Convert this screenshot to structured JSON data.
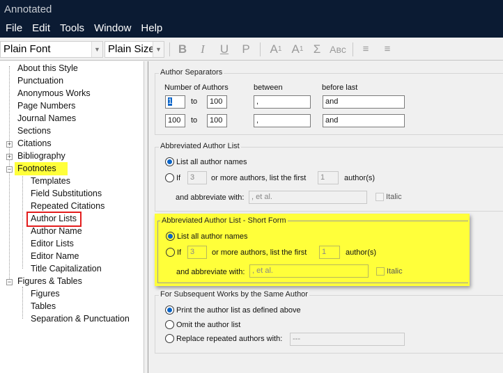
{
  "window": {
    "title": "Annotated"
  },
  "menu": [
    "File",
    "Edit",
    "Tools",
    "Window",
    "Help"
  ],
  "toolbar": {
    "font": "Plain Font",
    "size": "Plain Size",
    "bold": "B",
    "italic": "I",
    "underline": "U",
    "plain": "P",
    "superscript_a": "A",
    "superscript_1": "1",
    "subscript_a": "A",
    "subscript_1": "1",
    "symbol": "Σ",
    "smallcaps": "Aʙᴄ"
  },
  "tree": {
    "about": "About this Style",
    "punctuation": "Punctuation",
    "anonymous": "Anonymous Works",
    "page_numbers": "Page Numbers",
    "journal_names": "Journal Names",
    "sections": "Sections",
    "citations": "Citations",
    "bibliography": "Bibliography",
    "footnotes": "Footnotes",
    "templates": "Templates",
    "field_subs": "Field Substitutions",
    "repeated": "Repeated Citations",
    "author_lists": "Author Lists",
    "author_name": "Author Name",
    "editor_lists": "Editor Lists",
    "editor_name": "Editor Name",
    "title_cap": "Title Capitalization",
    "figures_tables": "Figures & Tables",
    "figures": "Figures",
    "tables": "Tables",
    "sep_punct": "Separation & Punctuation"
  },
  "separators": {
    "title": "Author Separators",
    "col_number": "Number of Authors",
    "col_between": "between",
    "col_before_last": "before last",
    "to": "to",
    "row1": {
      "from": "1",
      "to": "100",
      "between": ",",
      "before_last": "and"
    },
    "row2": {
      "from": "100",
      "to": "100",
      "between": ",",
      "before_last": "and"
    }
  },
  "abbrev": {
    "title": "Abbreviated Author List",
    "list_all": "List all author names",
    "if": "If",
    "if_value": "3",
    "more_text": "or more authors, list the first",
    "first_value": "1",
    "authors_suffix": "author(s)",
    "abbrev_with": "and abbreviate with:",
    "abbrev_value": ", et al.",
    "italic": "Italic"
  },
  "abbrev_short": {
    "title": "Abbreviated Author List - Short Form",
    "list_all": "List all author names",
    "if": "If",
    "if_value": "3",
    "more_text": "or more authors, list the first",
    "first_value": "1",
    "authors_suffix": "author(s)",
    "abbrev_with": "and abbreviate with:",
    "abbrev_value": ", et al.",
    "italic": "Italic"
  },
  "subsequent": {
    "title": "For Subsequent Works by the Same Author",
    "print": "Print the author list as defined above",
    "omit": "Omit the author list",
    "replace": "Replace repeated authors with:",
    "replace_value": "---"
  }
}
